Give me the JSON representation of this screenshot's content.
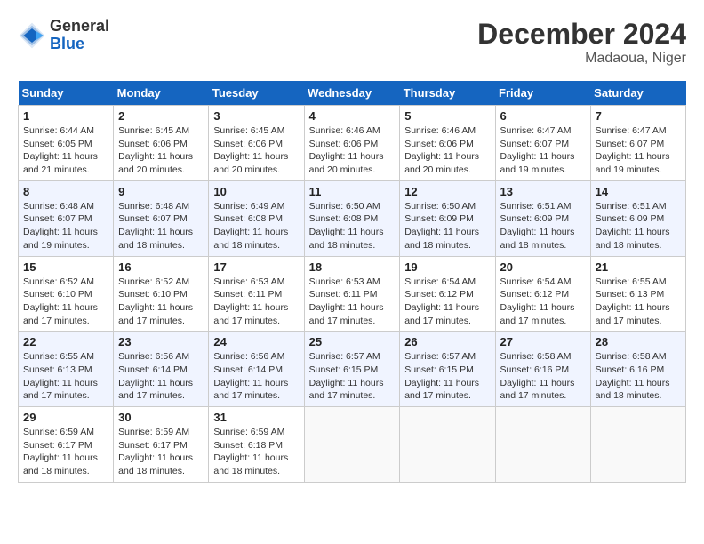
{
  "header": {
    "logo_line1": "General",
    "logo_line2": "Blue",
    "month_year": "December 2024",
    "location": "Madaoua, Niger"
  },
  "weekdays": [
    "Sunday",
    "Monday",
    "Tuesday",
    "Wednesday",
    "Thursday",
    "Friday",
    "Saturday"
  ],
  "weeks": [
    [
      {
        "day": "1",
        "info": "Sunrise: 6:44 AM\nSunset: 6:05 PM\nDaylight: 11 hours\nand 21 minutes."
      },
      {
        "day": "2",
        "info": "Sunrise: 6:45 AM\nSunset: 6:06 PM\nDaylight: 11 hours\nand 20 minutes."
      },
      {
        "day": "3",
        "info": "Sunrise: 6:45 AM\nSunset: 6:06 PM\nDaylight: 11 hours\nand 20 minutes."
      },
      {
        "day": "4",
        "info": "Sunrise: 6:46 AM\nSunset: 6:06 PM\nDaylight: 11 hours\nand 20 minutes."
      },
      {
        "day": "5",
        "info": "Sunrise: 6:46 AM\nSunset: 6:06 PM\nDaylight: 11 hours\nand 20 minutes."
      },
      {
        "day": "6",
        "info": "Sunrise: 6:47 AM\nSunset: 6:07 PM\nDaylight: 11 hours\nand 19 minutes."
      },
      {
        "day": "7",
        "info": "Sunrise: 6:47 AM\nSunset: 6:07 PM\nDaylight: 11 hours\nand 19 minutes."
      }
    ],
    [
      {
        "day": "8",
        "info": "Sunrise: 6:48 AM\nSunset: 6:07 PM\nDaylight: 11 hours\nand 19 minutes."
      },
      {
        "day": "9",
        "info": "Sunrise: 6:48 AM\nSunset: 6:07 PM\nDaylight: 11 hours\nand 18 minutes."
      },
      {
        "day": "10",
        "info": "Sunrise: 6:49 AM\nSunset: 6:08 PM\nDaylight: 11 hours\nand 18 minutes."
      },
      {
        "day": "11",
        "info": "Sunrise: 6:50 AM\nSunset: 6:08 PM\nDaylight: 11 hours\nand 18 minutes."
      },
      {
        "day": "12",
        "info": "Sunrise: 6:50 AM\nSunset: 6:09 PM\nDaylight: 11 hours\nand 18 minutes."
      },
      {
        "day": "13",
        "info": "Sunrise: 6:51 AM\nSunset: 6:09 PM\nDaylight: 11 hours\nand 18 minutes."
      },
      {
        "day": "14",
        "info": "Sunrise: 6:51 AM\nSunset: 6:09 PM\nDaylight: 11 hours\nand 18 minutes."
      }
    ],
    [
      {
        "day": "15",
        "info": "Sunrise: 6:52 AM\nSunset: 6:10 PM\nDaylight: 11 hours\nand 17 minutes."
      },
      {
        "day": "16",
        "info": "Sunrise: 6:52 AM\nSunset: 6:10 PM\nDaylight: 11 hours\nand 17 minutes."
      },
      {
        "day": "17",
        "info": "Sunrise: 6:53 AM\nSunset: 6:11 PM\nDaylight: 11 hours\nand 17 minutes."
      },
      {
        "day": "18",
        "info": "Sunrise: 6:53 AM\nSunset: 6:11 PM\nDaylight: 11 hours\nand 17 minutes."
      },
      {
        "day": "19",
        "info": "Sunrise: 6:54 AM\nSunset: 6:12 PM\nDaylight: 11 hours\nand 17 minutes."
      },
      {
        "day": "20",
        "info": "Sunrise: 6:54 AM\nSunset: 6:12 PM\nDaylight: 11 hours\nand 17 minutes."
      },
      {
        "day": "21",
        "info": "Sunrise: 6:55 AM\nSunset: 6:13 PM\nDaylight: 11 hours\nand 17 minutes."
      }
    ],
    [
      {
        "day": "22",
        "info": "Sunrise: 6:55 AM\nSunset: 6:13 PM\nDaylight: 11 hours\nand 17 minutes."
      },
      {
        "day": "23",
        "info": "Sunrise: 6:56 AM\nSunset: 6:14 PM\nDaylight: 11 hours\nand 17 minutes."
      },
      {
        "day": "24",
        "info": "Sunrise: 6:56 AM\nSunset: 6:14 PM\nDaylight: 11 hours\nand 17 minutes."
      },
      {
        "day": "25",
        "info": "Sunrise: 6:57 AM\nSunset: 6:15 PM\nDaylight: 11 hours\nand 17 minutes."
      },
      {
        "day": "26",
        "info": "Sunrise: 6:57 AM\nSunset: 6:15 PM\nDaylight: 11 hours\nand 17 minutes."
      },
      {
        "day": "27",
        "info": "Sunrise: 6:58 AM\nSunset: 6:16 PM\nDaylight: 11 hours\nand 17 minutes."
      },
      {
        "day": "28",
        "info": "Sunrise: 6:58 AM\nSunset: 6:16 PM\nDaylight: 11 hours\nand 18 minutes."
      }
    ],
    [
      {
        "day": "29",
        "info": "Sunrise: 6:59 AM\nSunset: 6:17 PM\nDaylight: 11 hours\nand 18 minutes."
      },
      {
        "day": "30",
        "info": "Sunrise: 6:59 AM\nSunset: 6:17 PM\nDaylight: 11 hours\nand 18 minutes."
      },
      {
        "day": "31",
        "info": "Sunrise: 6:59 AM\nSunset: 6:18 PM\nDaylight: 11 hours\nand 18 minutes."
      },
      {
        "day": "",
        "info": ""
      },
      {
        "day": "",
        "info": ""
      },
      {
        "day": "",
        "info": ""
      },
      {
        "day": "",
        "info": ""
      }
    ]
  ]
}
